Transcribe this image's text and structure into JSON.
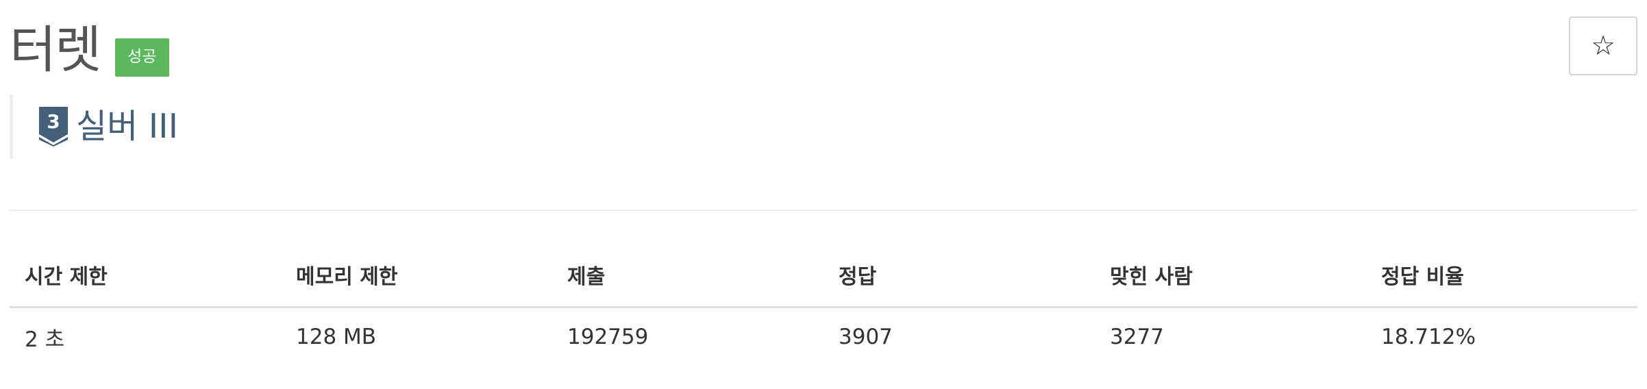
{
  "problem": {
    "title": "터렛",
    "status_badge": "성공",
    "star_icon": "star-outline-icon",
    "star_glyph": "☆"
  },
  "tier": {
    "level_number": "3",
    "label": "실버 III",
    "color": "#435f7a",
    "icon": "silver-tier-icon"
  },
  "colors": {
    "success_badge": "#5cb85c",
    "title_text": "#555555"
  },
  "stats": {
    "headers": [
      "시간 제한",
      "메모리 제한",
      "제출",
      "정답",
      "맞힌 사람",
      "정답 비율"
    ],
    "values": [
      "2 초",
      "128 MB",
      "192759",
      "3907",
      "3277",
      "18.712%"
    ]
  }
}
